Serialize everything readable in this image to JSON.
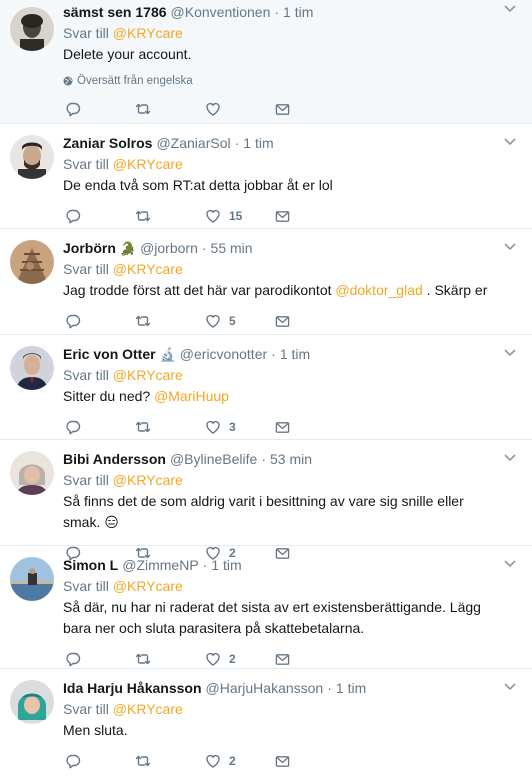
{
  "tweets": [
    {
      "name": "sämst sen 1786",
      "emoji": "",
      "handle": "@Konventionen",
      "time": "1 tim",
      "reply_prefix": "Svar till",
      "reply_mention": "@KRYcare",
      "text": "Delete your account.",
      "translate": "Översätt från engelska",
      "likes": ""
    },
    {
      "name": "Zaniar Solros",
      "emoji": "",
      "handle": "@ZaniarSol",
      "time": "1 tim",
      "reply_prefix": "Svar till",
      "reply_mention": "@KRYcare",
      "text": "De enda två som RT:at detta jobbar åt er lol",
      "likes": "15"
    },
    {
      "name": "Jorbörn",
      "emoji": "🐊",
      "handle": "@jorborn",
      "time": "55 min",
      "reply_prefix": "Svar till",
      "reply_mention": "@KRYcare",
      "text_before": "Jag trodde först att det här var parodikontot ",
      "text_mention": "@doktor_glad",
      "text_after": " . Skärp er",
      "likes": "5"
    },
    {
      "name": "Eric von Otter",
      "emoji": "🔬",
      "handle": "@ericvonotter",
      "time": "1 tim",
      "reply_prefix": "Svar till",
      "reply_mention": "@KRYcare",
      "text_before": "Sitter du ned? ",
      "text_mention": "@MariHuup",
      "likes": "3"
    },
    {
      "name": "Bibi Andersson",
      "emoji": "",
      "handle": "@BylineBelife",
      "time": "53 min",
      "reply_prefix": "Svar till",
      "reply_mention": "@KRYcare",
      "text": "Så finns det de som aldrig varit i besittning av vare sig snille eller smak. 😑",
      "likes": "2"
    },
    {
      "name": "Simon L",
      "emoji": "",
      "handle": "@ZimmeNP",
      "time": "1 tim",
      "reply_prefix": "Svar till",
      "reply_mention": "@KRYcare",
      "text": "Så där, nu har ni raderat det sista av ert existensberättigande. Lägg bara ner och sluta parasitera på skattebetalarna.",
      "likes": "2"
    },
    {
      "name": "Ida Harju Håkansson",
      "emoji": "",
      "handle": "@HarjuHakansson",
      "time": "1 tim",
      "reply_prefix": "Svar till",
      "reply_mention": "@KRYcare",
      "text": "Men sluta.",
      "likes": "2"
    }
  ],
  "colors": {
    "mention": "#f5a623",
    "muted": "#657786",
    "border": "#e6ecf0",
    "highlight_bg": "#f5f8fa"
  },
  "icons": {
    "reply": "reply-icon",
    "retweet": "retweet-icon",
    "like": "heart-icon",
    "dm": "envelope-icon",
    "more": "chevron-down-icon",
    "translate": "globe-icon"
  },
  "separator": "·"
}
